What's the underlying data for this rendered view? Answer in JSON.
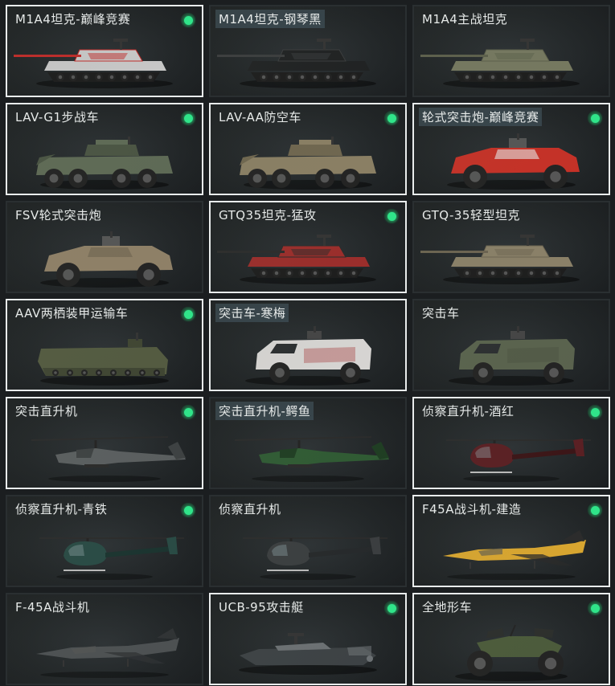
{
  "vehicles": [
    {
      "label": "M1A4坦克-巅峰竞赛",
      "kind": "tank",
      "paint": "#c8c8c8",
      "accent": "#c02a28",
      "selected": true,
      "boxed": false,
      "owned": true
    },
    {
      "label": "M1A4坦克-钢琴黑",
      "kind": "tank",
      "paint": "#1f2122",
      "accent": "#3a3c3d",
      "selected": false,
      "boxed": true,
      "owned": false
    },
    {
      "label": "M1A4主战坦克",
      "kind": "tank",
      "paint": "#75785f",
      "accent": "#5c5f4b",
      "selected": false,
      "boxed": false,
      "owned": false
    },
    {
      "label": "LAV-G1步战车",
      "kind": "apc",
      "paint": "#5e6a55",
      "accent": "#4a5443",
      "selected": true,
      "boxed": false,
      "owned": true
    },
    {
      "label": "LAV-AA防空车",
      "kind": "apc",
      "paint": "#8a7f64",
      "accent": "#6f664f",
      "selected": true,
      "boxed": false,
      "owned": true
    },
    {
      "label": "轮式突击炮-巅峰竞赛",
      "kind": "jeep",
      "paint": "#c63026",
      "accent": "#e8e8e8",
      "selected": true,
      "boxed": true,
      "owned": true
    },
    {
      "label": "FSV轮式突击炮",
      "kind": "jeep",
      "paint": "#8f8067",
      "accent": "#6d624f",
      "selected": false,
      "boxed": false,
      "owned": false
    },
    {
      "label": "GTQ35坦克-猛攻",
      "kind": "tank",
      "paint": "#9b2c2a",
      "accent": "#2a2a2a",
      "selected": true,
      "boxed": false,
      "owned": true
    },
    {
      "label": "GTQ-35轻型坦克",
      "kind": "tank",
      "paint": "#8a8068",
      "accent": "#6b6350",
      "selected": false,
      "boxed": false,
      "owned": false
    },
    {
      "label": "AAV两栖装甲运输车",
      "kind": "aav",
      "paint": "#535a40",
      "accent": "#3f4532",
      "selected": true,
      "boxed": false,
      "owned": true
    },
    {
      "label": "突击车-寒梅",
      "kind": "truck",
      "paint": "#d8d6d4",
      "accent": "#a22b2b",
      "selected": true,
      "boxed": true,
      "owned": false
    },
    {
      "label": "突击车",
      "kind": "truck",
      "paint": "#59624d",
      "accent": "#454c3b",
      "selected": false,
      "boxed": false,
      "owned": false
    },
    {
      "label": "突击直升机",
      "kind": "heli",
      "paint": "#5a5e5f",
      "accent": "#3d4142",
      "selected": true,
      "boxed": false,
      "owned": true
    },
    {
      "label": "突击直升机-鳄鱼",
      "kind": "heli",
      "paint": "#2f5a33",
      "accent": "#1e3d22",
      "selected": false,
      "boxed": true,
      "owned": false
    },
    {
      "label": "侦察直升机-酒红",
      "kind": "lightheli",
      "paint": "#5a1e22",
      "accent": "#3b1416",
      "selected": true,
      "boxed": false,
      "owned": true
    },
    {
      "label": "侦察直升机-青铁",
      "kind": "lightheli",
      "paint": "#284a44",
      "accent": "#1a332f",
      "selected": false,
      "boxed": false,
      "owned": true
    },
    {
      "label": "侦察直升机",
      "kind": "lightheli",
      "paint": "#3a3d3f",
      "accent": "#25282a",
      "selected": false,
      "boxed": false,
      "owned": false
    },
    {
      "label": "F45A战斗机-建造",
      "kind": "jet",
      "paint": "#d9a62f",
      "accent": "#2a2a2a",
      "selected": true,
      "boxed": false,
      "owned": true
    },
    {
      "label": "F-45A战斗机",
      "kind": "jet",
      "paint": "#4c5052",
      "accent": "#2f3234",
      "selected": false,
      "boxed": false,
      "owned": false
    },
    {
      "label": "UCB-95攻击艇",
      "kind": "boat",
      "paint": "#3c4144",
      "accent": "#6b7073",
      "selected": true,
      "boxed": false,
      "owned": true
    },
    {
      "label": "全地形车",
      "kind": "atv",
      "paint": "#4b5a3a",
      "accent": "#2b2d2b",
      "selected": true,
      "boxed": false,
      "owned": true
    }
  ]
}
